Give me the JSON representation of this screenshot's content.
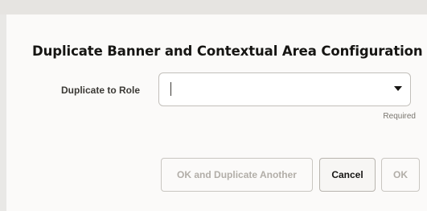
{
  "dialog": {
    "title": "Duplicate Banner and Contextual Area Configuration"
  },
  "form": {
    "duplicate_to_role": {
      "label": "Duplicate to Role",
      "value": "",
      "dropdown_icon": "chevron-down-icon",
      "required_text": "Required"
    }
  },
  "buttons": {
    "ok_and_duplicate_another": {
      "label": "OK and Duplicate Another",
      "disabled": true
    },
    "cancel": {
      "label": "Cancel",
      "disabled": false
    },
    "ok": {
      "label": "OK",
      "disabled": true
    }
  },
  "colors": {
    "title_text": "#161513",
    "disabled_text": "#b2aea8",
    "dialog_background": "#fbfaf9",
    "field_border": "#c2bfba"
  }
}
